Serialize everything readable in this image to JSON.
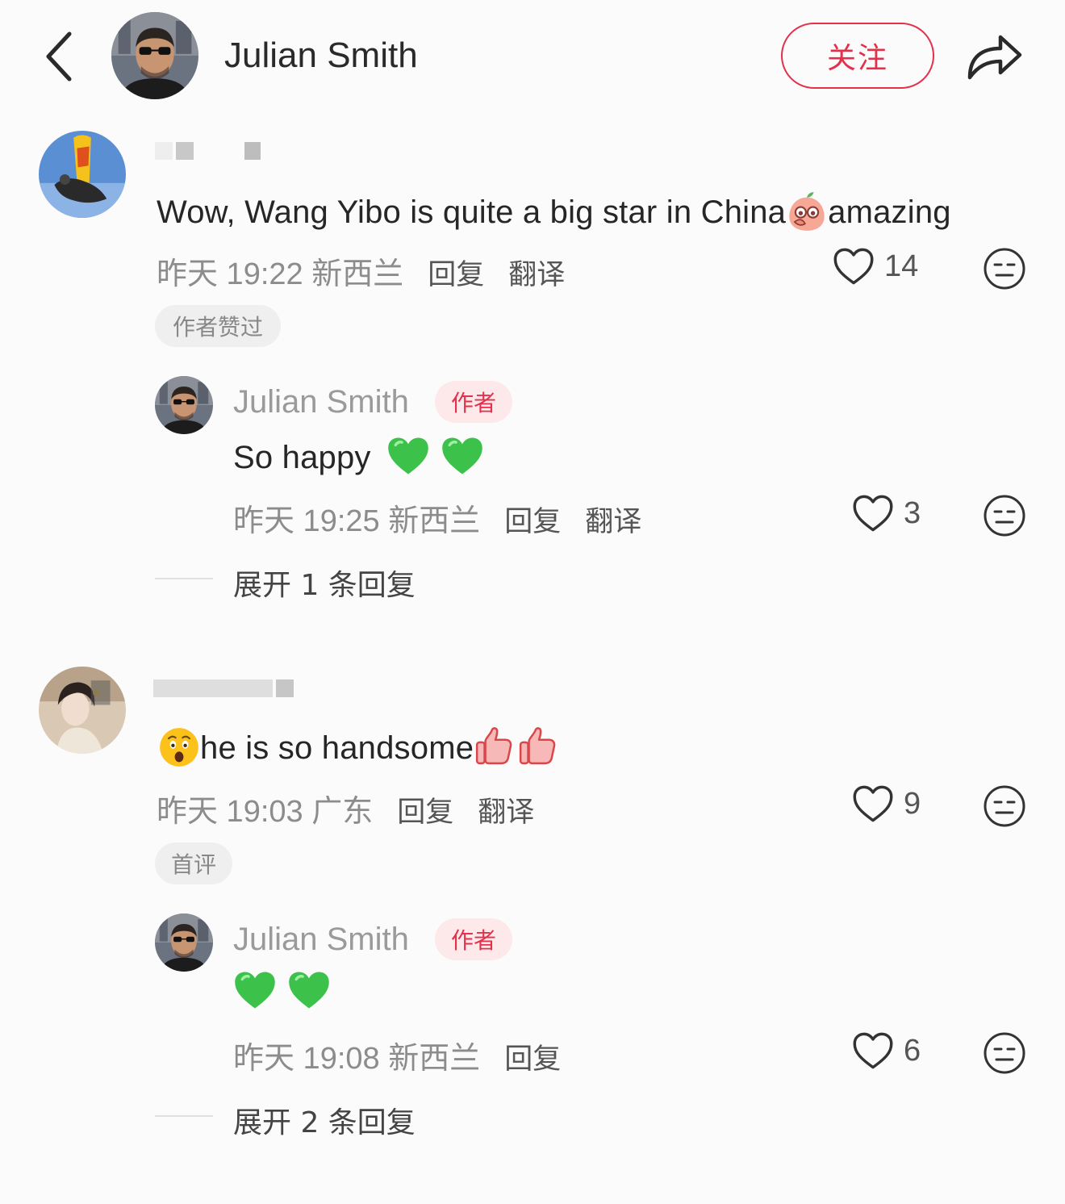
{
  "header": {
    "back_icon": "chevron-left-icon",
    "author_name": "Julian Smith",
    "follow_label": "关注",
    "share_icon": "share-icon"
  },
  "colors": {
    "accent": "#e3304b",
    "badge_bg": "#fde8ea",
    "meta_text": "#8c8c8c",
    "background": "#fbfbfb"
  },
  "comments": [
    {
      "text_before": "Wow, Wang Yibo is quite a big star in China",
      "text_after": "amazing",
      "time": "昨天 19:22 新西兰",
      "reply_label": "回复",
      "translate_label": "翻译",
      "likes": "14",
      "tag": "作者赞过",
      "reply": {
        "name": "Julian Smith",
        "badge": "作者",
        "text": "So happy",
        "time": "昨天 19:25 新西兰",
        "reply_label": "回复",
        "translate_label": "翻译",
        "likes": "3"
      },
      "expand_label": "展开 1 条回复"
    },
    {
      "text": "he is so handsome",
      "time": "昨天 19:03 广东",
      "reply_label": "回复",
      "translate_label": "翻译",
      "likes": "9",
      "tag": "首评",
      "reply": {
        "name": "Julian Smith",
        "badge": "作者",
        "time": "昨天 19:08 新西兰",
        "reply_label": "回复",
        "likes": "6"
      },
      "expand_label": "展开 2 条回复"
    }
  ]
}
